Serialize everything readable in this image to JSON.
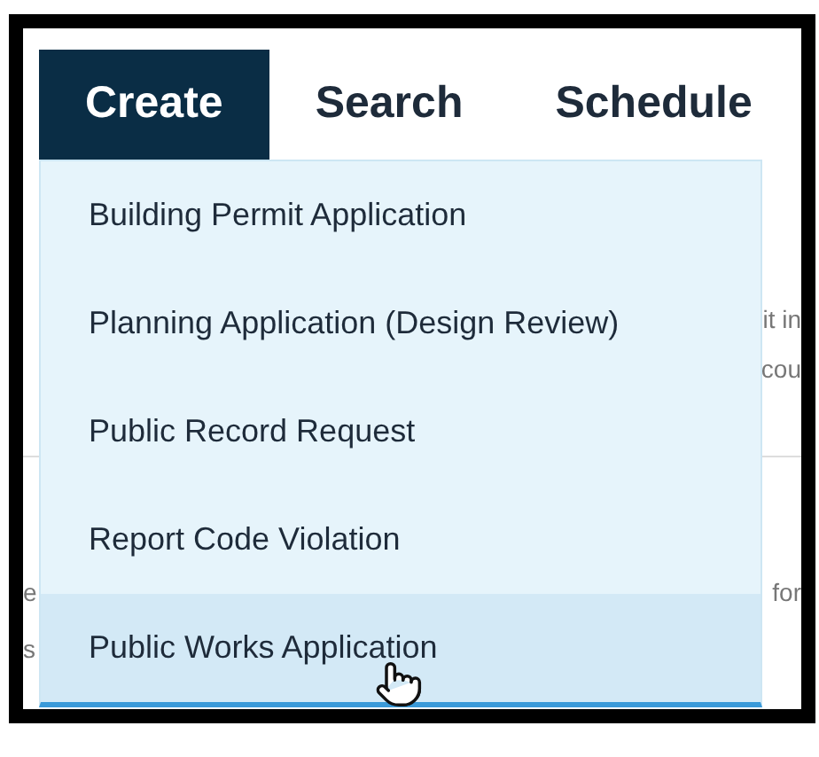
{
  "tabs": [
    {
      "label": "Create",
      "selected": true
    },
    {
      "label": "Search",
      "selected": false
    },
    {
      "label": "Schedule",
      "selected": false
    }
  ],
  "menu": {
    "items": [
      {
        "label": "Building Permit Application",
        "highlighted": false
      },
      {
        "label": "Planning Application (Design Review)",
        "highlighted": false
      },
      {
        "label": "Public Record Request",
        "highlighted": false
      },
      {
        "label": "Report Code Violation",
        "highlighted": false
      },
      {
        "label": "Public Works Application",
        "highlighted": true
      }
    ]
  },
  "background_rows": [
    {
      "right": "it in"
    },
    {
      "right": "cou"
    },
    {
      "left": "e",
      "right": "for"
    },
    {
      "left": "s"
    }
  ]
}
